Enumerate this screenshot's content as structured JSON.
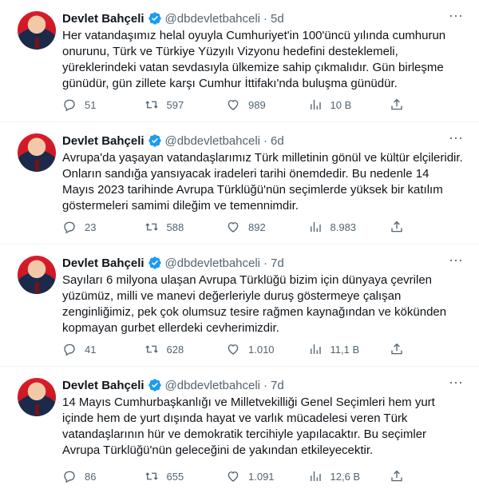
{
  "tweets": [
    {
      "name": "Devlet Bahçeli",
      "handle": "@dbdevletbahceli",
      "time": "5d",
      "text": "Her vatandaşımız helal oyuyla Cumhuriyet'in 100'üncü yılında cumhurun onurunu, Türk ve Türkiye Yüzyılı Vizyonu hedefini desteklemeli, yüreklerindeki vatan sevdasıyla ülkemize sahip çıkmalıdır. Gün birleşme günüdür, gün zillete karşı Cumhur İttifakı'nda buluşma günüdür.",
      "replies": "51",
      "retweets": "597",
      "likes": "989",
      "views": "10 B"
    },
    {
      "name": "Devlet Bahçeli",
      "handle": "@dbdevletbahceli",
      "time": "6d",
      "text": "Avrupa'da yaşayan vatandaşlarımız Türk milletinin gönül ve kültür elçileridir. Onların sandığa yansıyacak iradeleri tarihi önemdedir. Bu nedenle 14 Mayıs 2023 tarihinde Avrupa Türklüğü'nün seçimlerde yüksek bir katılım göstermeleri samimi dileğim ve temennimdir.",
      "replies": "23",
      "retweets": "588",
      "likes": "892",
      "views": "8.983"
    },
    {
      "name": "Devlet Bahçeli",
      "handle": "@dbdevletbahceli",
      "time": "7d",
      "text": "Sayıları 6 milyona ulaşan Avrupa Türklüğü bizim için dünyaya çevrilen yüzümüz, milli ve manevi değerleriyle duruş göstermeye çalışan zenginliğimiz, pek çok olumsuz tesire rağmen kaynağından ve kökünden kopmayan gurbet ellerdeki cevherimizdir.",
      "replies": "41",
      "retweets": "628",
      "likes": "1.010",
      "views": "11,1 B"
    },
    {
      "name": "Devlet Bahçeli",
      "handle": "@dbdevletbahceli",
      "time": "7d",
      "text": "14 Mayıs Cumhurbaşkanlığı ve Milletvekilliği Genel Seçimleri hem yurt içinde hem de yurt dışında hayat ve varlık mücadelesi veren Türk vatandaşlarının hür ve demokratik tercihiyle yapılacaktır. Bu seçimler Avrupa Türklüğü'nün geleceğini de yakından etkileyecektir.",
      "replies": "86",
      "retweets": "655",
      "likes": "1.091",
      "views": "12,6 B"
    }
  ],
  "icons": {
    "verified": "verified-badge-icon",
    "reply": "reply-icon",
    "retweet": "retweet-icon",
    "like": "like-icon",
    "views": "views-icon",
    "share": "share-icon",
    "more": "more-icon"
  },
  "colors": {
    "verified": "#1d9bf0",
    "muted": "#536471",
    "text": "#0f1419",
    "divider": "#eff3f4"
  }
}
